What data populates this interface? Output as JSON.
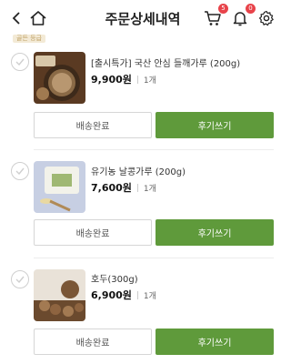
{
  "header": {
    "title": "주문상세내역",
    "cart_badge": "5",
    "bell_badge": "0"
  },
  "tag": "골든 등급",
  "items": [
    {
      "name": "[출시특가] 국산 안심 들깨가루 (200g)",
      "price": "9,900원",
      "qty": "1개",
      "status_button": "배송완료",
      "review_button": "후기쓰기"
    },
    {
      "name": "유기농 날콩가루 (200g)",
      "price": "7,600원",
      "qty": "1개",
      "status_button": "배송완료",
      "review_button": "후기쓰기"
    },
    {
      "name": "호두(300g)",
      "price": "6,900원",
      "qty": "1개",
      "status_button": "배송완료",
      "review_button": "후기쓰기"
    }
  ],
  "colors": {
    "accent_green": "#5f9a3b",
    "badge_red": "#e8434a"
  }
}
